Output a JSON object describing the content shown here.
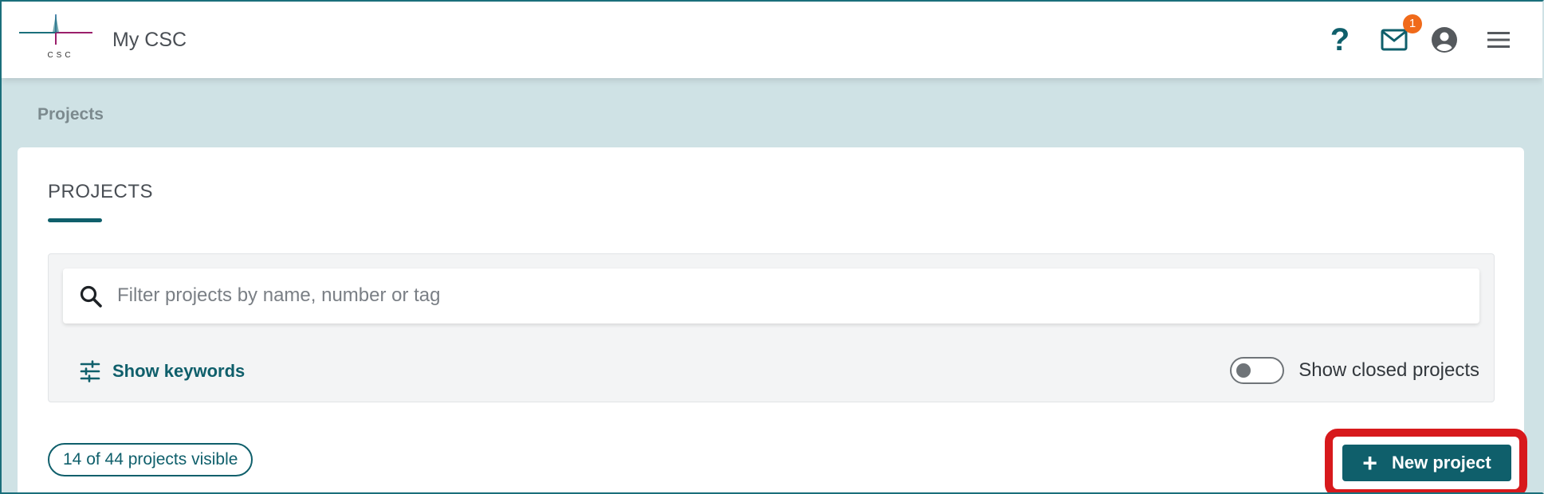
{
  "header": {
    "logo_text": "CSC",
    "app_title": "My CSC",
    "help_glyph": "?",
    "notification_count": "1",
    "icons": [
      "help-icon",
      "mail-icon",
      "account-icon",
      "menu-icon"
    ]
  },
  "breadcrumb": {
    "label": "Projects"
  },
  "card": {
    "title": "PROJECTS",
    "search": {
      "placeholder": "Filter projects by name, number or tag",
      "value": ""
    },
    "show_keywords_label": "Show keywords",
    "show_closed_label": "Show closed projects",
    "show_closed_on": false,
    "visible_count_label": "14 of 44 projects visible",
    "new_project_label": "New project",
    "new_project_icon": "+"
  },
  "colors": {
    "accent": "#0f5f6b",
    "page_background": "#cfe2e5",
    "badge": "#f06a1a",
    "highlight": "#d7191c"
  }
}
